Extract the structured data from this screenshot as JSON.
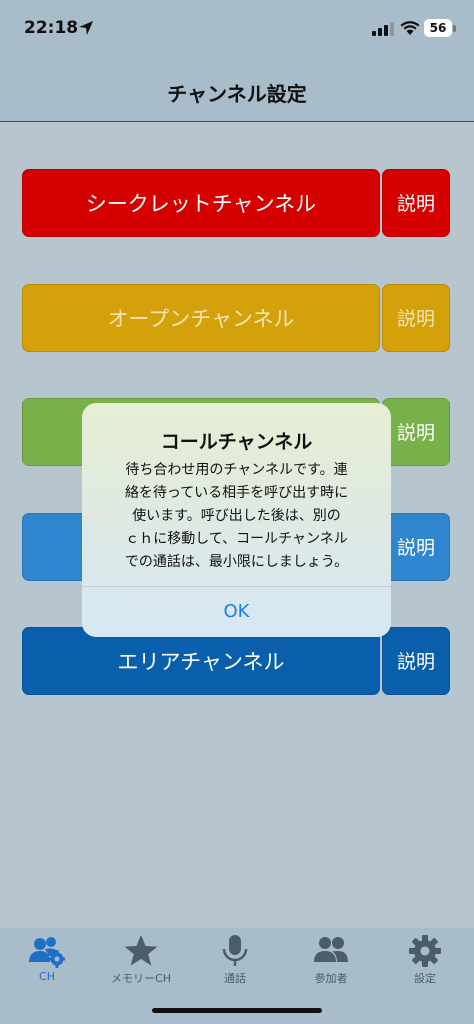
{
  "status_bar": {
    "time": "22:18",
    "battery": "56"
  },
  "nav": {
    "title": "チャンネル設定"
  },
  "channels": [
    {
      "label": "シークレットチャンネル",
      "desc": "説明",
      "color": "#d50000",
      "text_color": "#ffffff"
    },
    {
      "label": "オープンチャンネル",
      "desc": "説明",
      "color": "#d4a10a",
      "text_color": "#f2e3b8"
    },
    {
      "label": "",
      "desc": "説明",
      "color": "#78b04a",
      "text_color": "#ffffff"
    },
    {
      "label": "",
      "desc": "説明",
      "color": "#2f86cf",
      "text_color": "#ffffff"
    },
    {
      "label": "エリアチャンネル",
      "desc": "説明",
      "color": "#095fab",
      "text_color": "#ffffff"
    }
  ],
  "alert": {
    "title": "コールチャンネル",
    "lines": [
      "待ち合わせ用のチャンネルです。連",
      "絡を待っている相手を呼び出す時に",
      "使います。呼び出した後は、別の",
      "ｃｈに移動して、コールチャンネル",
      "での通話は、最小限にしましょう。"
    ],
    "ok_label": "OK"
  },
  "tabs": [
    {
      "label": "CH",
      "icon": "users-gear-icon",
      "active": true
    },
    {
      "label": "メモリーCH",
      "icon": "star-icon",
      "active": false
    },
    {
      "label": "通話",
      "icon": "microphone-icon",
      "active": false
    },
    {
      "label": "参加者",
      "icon": "users-icon",
      "active": false
    },
    {
      "label": "設定",
      "icon": "gear-icon",
      "active": false
    }
  ],
  "colors": {
    "accent": "#1d70c9",
    "tab_inactive": "#4b5d6b",
    "ok_blue": "#1a7ee8"
  }
}
